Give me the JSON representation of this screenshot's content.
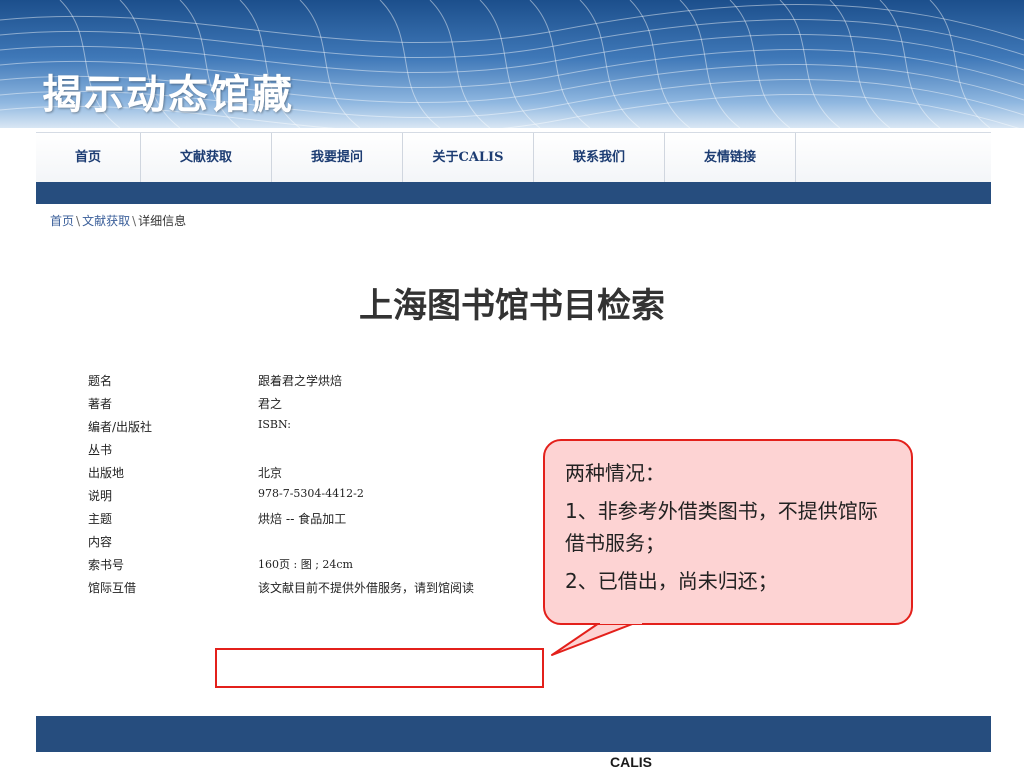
{
  "slide": {
    "title": "揭示动态馆藏"
  },
  "nav": {
    "items": [
      "首页",
      "文献获取",
      "我要提问",
      "关于CALIS",
      "联系我们",
      "友情链接"
    ]
  },
  "breadcrumb": {
    "home": "首页",
    "section": "文献获取",
    "current": "详细信息",
    "separator": "\\"
  },
  "page": {
    "heading": "上海图书馆书目检索"
  },
  "record": {
    "rows": [
      {
        "label": "题名",
        "value": "跟着君之学烘焙"
      },
      {
        "label": "著者",
        "value": "君之"
      },
      {
        "label": "编者/出版社",
        "value": "ISBN:"
      },
      {
        "label": "丛书",
        "value": ""
      },
      {
        "label": "出版地",
        "value": "北京"
      },
      {
        "label": "说明",
        "value": "978-7-5304-4412-2"
      },
      {
        "label": "主题",
        "value": "烘焙 -- 食品加工"
      },
      {
        "label": "内容",
        "value": ""
      },
      {
        "label": "索书号",
        "value": "160页 : 图 ; 24cm"
      },
      {
        "label": "馆际互借",
        "value": "该文献目前不提供外借服务，请到馆阅读"
      }
    ]
  },
  "callout": {
    "title": "两种情况：",
    "line1": "1、非参考外借类图书，不提供馆际借书服务；",
    "line2": "2、已借出，尚未归还；"
  },
  "footer": {
    "logo": "CALIS"
  },
  "colors": {
    "accent_red": "#e3201b",
    "callout_fill": "#fdd3d3",
    "nav_bar": "#264d7e",
    "nav_text": "#1d3d73"
  }
}
